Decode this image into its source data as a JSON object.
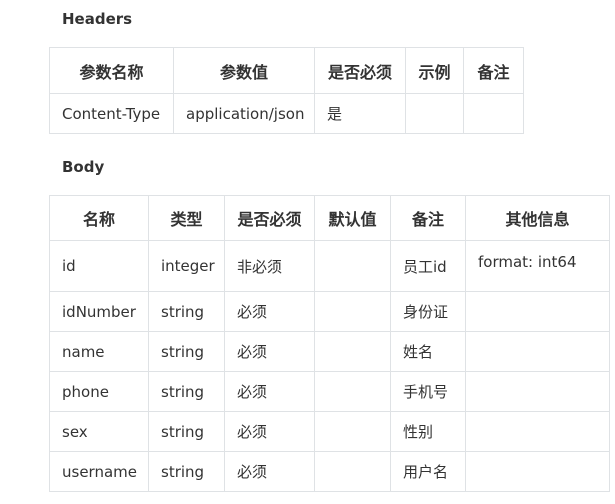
{
  "headers_section": {
    "title": "Headers",
    "columns": [
      "参数名称",
      "参数值",
      "是否必须",
      "示例",
      "备注"
    ],
    "rows": [
      [
        "Content-Type",
        "application/json",
        "是",
        "",
        ""
      ]
    ]
  },
  "body_section": {
    "title": "Body",
    "columns": [
      "名称",
      "类型",
      "是否必须",
      "默认值",
      "备注",
      "其他信息"
    ],
    "rows": [
      [
        "id",
        "integer",
        "非必须",
        "",
        "员工id",
        "format: int64"
      ],
      [
        "idNumber",
        "string",
        "必须",
        "",
        "身份证",
        ""
      ],
      [
        "name",
        "string",
        "必须",
        "",
        "姓名",
        ""
      ],
      [
        "phone",
        "string",
        "必须",
        "",
        "手机号",
        ""
      ],
      [
        "sex",
        "string",
        "必须",
        "",
        "性别",
        ""
      ],
      [
        "username",
        "string",
        "必须",
        "",
        "用户名",
        ""
      ]
    ]
  }
}
